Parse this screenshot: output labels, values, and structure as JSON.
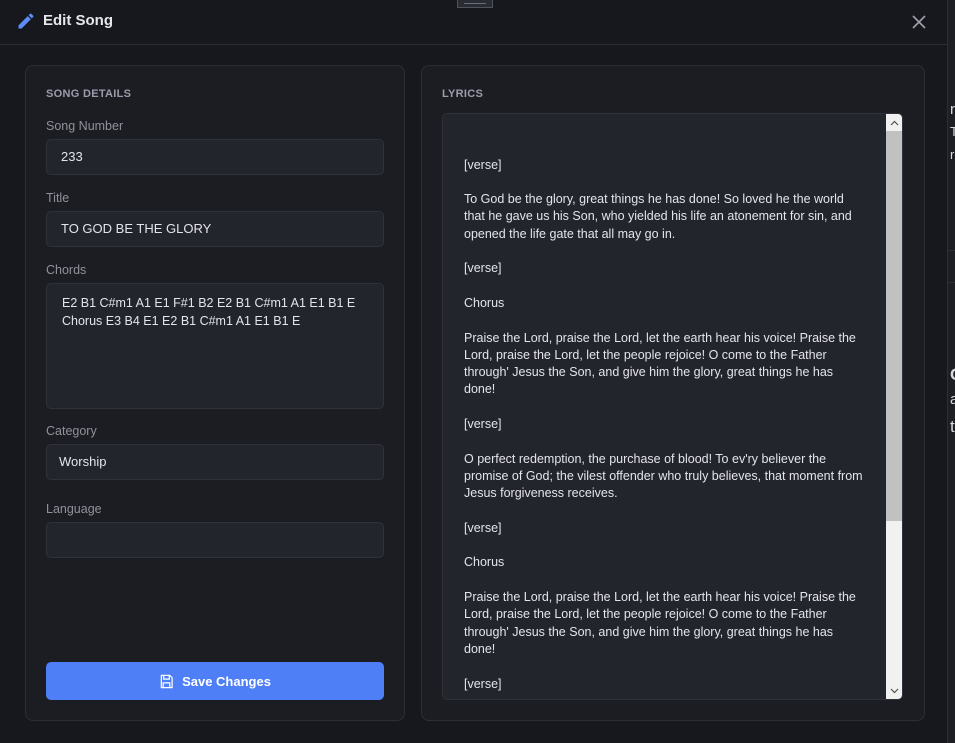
{
  "dialog": {
    "title": "Edit Song",
    "close_icon": "close-icon",
    "edit_icon": "pencil-icon"
  },
  "details": {
    "section_title": "SONG DETAILS",
    "song_number_label": "Song Number",
    "song_number": "233",
    "title_label": "Title",
    "title": "TO GOD BE THE GLORY",
    "chords_label": "Chords",
    "chords": "E2 B1 C#m1 A1 E1 F#1 B2 E2 B1 C#m1 A1 E1 B1 E\nChorus E3 B4 E1 E2 B1 C#m1 A1 E1 B1 E",
    "category_label": "Category",
    "category": "Worship",
    "language_label": "Language",
    "language": "",
    "save_label": "Save Changes"
  },
  "lyrics": {
    "section_title": "LYRICS",
    "text": "\n\n[verse]\n\nTo God be the glory, great things he has done! So loved he the world that he gave us his Son, who yielded his life an atonement for sin, and opened the life gate that all may go in.\n\n[verse]\n\nChorus\n\nPraise the Lord, praise the Lord, let the earth hear his voice! Praise the Lord, praise the Lord, let the people rejoice! O come to the Father through' Jesus the Son, and give him the glory, great things he has done!\n\n[verse]\n\nO perfect redemption, the purchase of blood! To ev'ry believer the promise of God; the vilest offender who truly believes, that moment from Jesus forgiveness receives.\n\n[verse]\n\nChorus\n\nPraise the Lord, praise the Lord, let the earth hear his voice! Praise the Lord, praise the Lord, let the people rejoice! O come to the Father through' Jesus the Son, and give him the glory, great things he has done!\n\n[verse]"
  },
  "background": {
    "fragment_1": "r",
    "fragment_2": "T",
    "fragment_3": "r",
    "fragment_4": "C",
    "fragment_5": "a",
    "fragment_6": "t"
  },
  "colors": {
    "accent": "#4f7ff7",
    "panel": "#1c1d23",
    "field": "#23252d"
  }
}
